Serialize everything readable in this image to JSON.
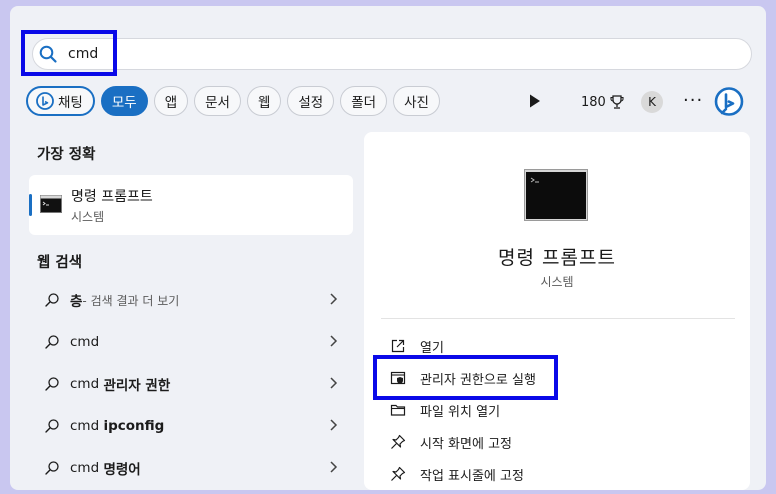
{
  "search": {
    "query": "cmd"
  },
  "tabs": {
    "chat_label": "채팅",
    "items": [
      "모두",
      "앱",
      "문서",
      "웹",
      "설정",
      "폴더",
      "사진"
    ]
  },
  "toolbar": {
    "points": "180",
    "avatar_initial": "K",
    "more_label": "···"
  },
  "left": {
    "best_match_title": "가장 정확",
    "best_match": {
      "name": "명령 프롬프트",
      "type": "시스템"
    },
    "web_title": "웹 검색",
    "web_results": [
      {
        "bold": "층",
        "rest": " - 검색 결과 더 보기"
      },
      {
        "plain": "cmd",
        "bold": ""
      },
      {
        "plain": "cmd ",
        "bold": "관리자 권한"
      },
      {
        "plain": "cmd ",
        "bold": "ipconfig"
      },
      {
        "plain": "cmd ",
        "bold": "명령어"
      }
    ]
  },
  "right": {
    "app_name": "명령 프롬프트",
    "app_type": "시스템",
    "actions": [
      "열기",
      "관리자 권한으로 실행",
      "파일 위치 열기",
      "시작 화면에 고정",
      "작업 표시줄에 고정"
    ]
  },
  "colors": {
    "accent": "#1a6fc3",
    "highlight": "#0a09e8",
    "background": "#c9c7f0"
  }
}
